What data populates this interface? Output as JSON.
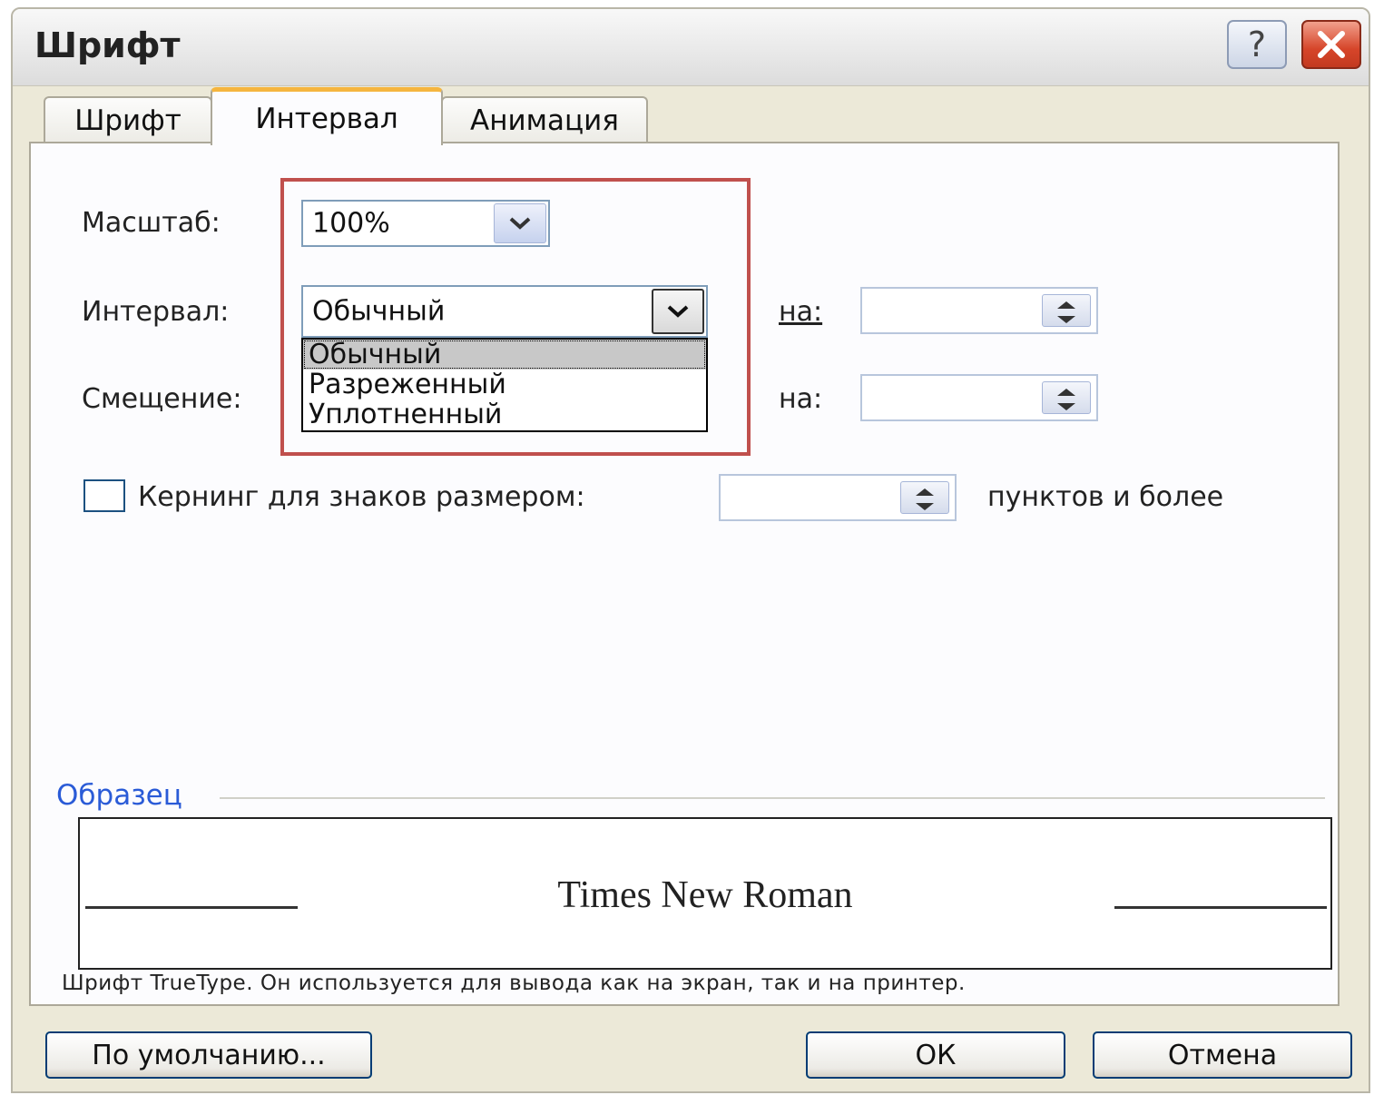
{
  "window": {
    "title": "Шрифт",
    "help_label": "?"
  },
  "tabs": [
    {
      "label": "Шрифт",
      "active": false
    },
    {
      "label": "Интервал",
      "active": true
    },
    {
      "label": "Анимация",
      "active": false
    }
  ],
  "scale": {
    "label": "Масштаб:",
    "value": "100%"
  },
  "spacing": {
    "label": "Интервал:",
    "value": "Обычный",
    "by_label": "на:",
    "options": [
      "Обычный",
      "Разреженный",
      "Уплотненный"
    ],
    "selected_option": "Обычный"
  },
  "position": {
    "label": "Смещение:",
    "by_label": "на:"
  },
  "kerning": {
    "label": "Кернинг для знаков размером:",
    "suffix": "пунктов и более",
    "checked": false
  },
  "preview": {
    "section_label": "Образец",
    "sample_text": "Times New Roman",
    "note": "Шрифт TrueType. Он используется для вывода как на экран, так и на принтер."
  },
  "buttons": {
    "default": "По умолчанию...",
    "ok": "ОК",
    "cancel": "Отмена"
  },
  "colors": {
    "highlight_frame": "#c0504d",
    "section_label": "#2a5bd7",
    "active_tab_accent": "#f5b53f"
  }
}
